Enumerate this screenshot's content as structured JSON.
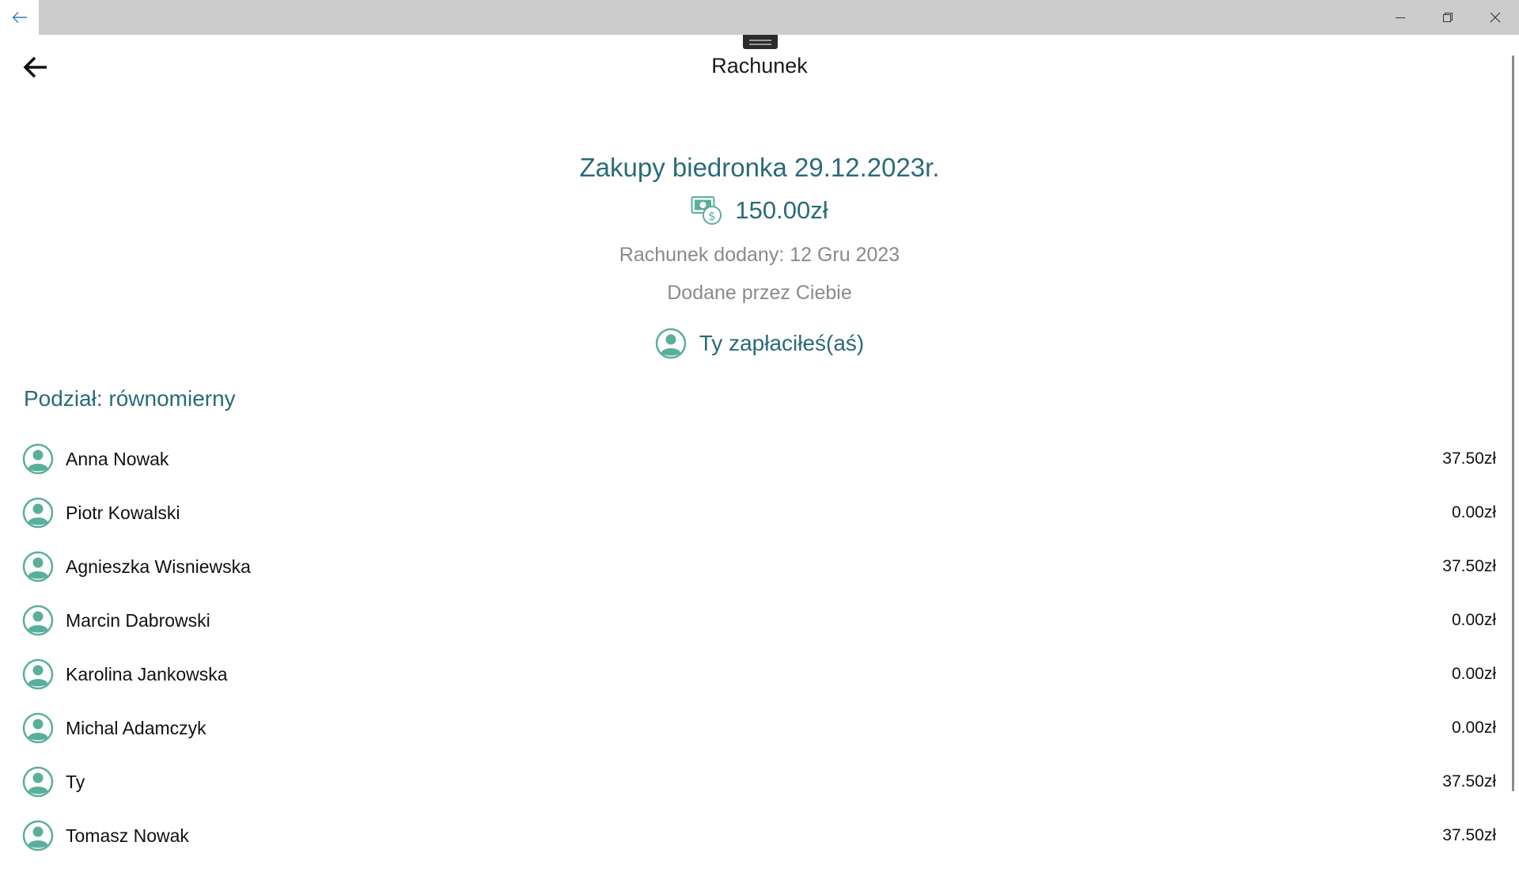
{
  "window": {
    "back_icon": "arrow-left-icon",
    "minimize_icon": "minimize-icon",
    "maximize_icon": "restore-icon",
    "close_icon": "close-icon"
  },
  "header": {
    "title": "Rachunek",
    "back_icon": "arrow-left-icon"
  },
  "bill": {
    "name": "Zakupy biedronka 29.12.2023r.",
    "amount": "150.00zł",
    "amount_icon": "money-icon",
    "added_date": "Rachunek dodany: 12 Gru 2023",
    "added_by": "Dodane przez Ciebie",
    "payer": "Ty zapłaciłeś(aś)",
    "payer_icon": "user-avatar-icon"
  },
  "split": {
    "heading": "Podział: równomierny",
    "participants": [
      {
        "name": "Anna Nowak",
        "amount": "37.50zł"
      },
      {
        "name": "Piotr Kowalski",
        "amount": "0.00zł"
      },
      {
        "name": "Agnieszka Wisniewska",
        "amount": "37.50zł"
      },
      {
        "name": "Marcin Dabrowski",
        "amount": "0.00zł"
      },
      {
        "name": "Karolina Jankowska",
        "amount": "0.00zł"
      },
      {
        "name": "Michal Adamczyk",
        "amount": "0.00zł"
      },
      {
        "name": "Ty",
        "amount": "37.50zł"
      },
      {
        "name": "Tomasz Nowak",
        "amount": "37.50zł"
      }
    ]
  },
  "colors": {
    "accent": "#2a6b78",
    "avatar": "#5aaf9c",
    "secondary_text": "#8a8a8a",
    "titlebar": "#cccccc"
  }
}
